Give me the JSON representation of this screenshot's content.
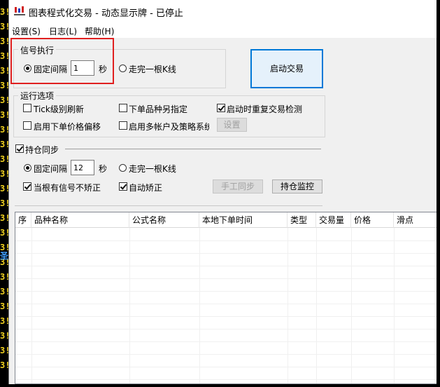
{
  "window": {
    "title": "图表程式化交易 - 动态显示牌 - 已停止",
    "app_icon_text": "财"
  },
  "menu": [
    "设置(S)",
    "日志(L)",
    "帮助(H)"
  ],
  "signal": {
    "legend": "信号执行",
    "fixed_interval_label": "固定间隔",
    "interval_value": "1",
    "seconds_unit": "秒",
    "bar_close_label": "走完一根K线",
    "fixed_selected": true
  },
  "start_button": "启动交易",
  "options": {
    "legend": "运行选项",
    "items": [
      {
        "label": "Tick级别刷新",
        "checked": false
      },
      {
        "label": "下单品种另指定",
        "checked": false
      },
      {
        "label": "启动时重复交易检测",
        "checked": true
      },
      {
        "label": "启用下单价格偏移",
        "checked": false
      },
      {
        "label": "启用多帐户及策略系统",
        "checked": false
      }
    ],
    "settings_button": "设置"
  },
  "position_sync": {
    "label": "持仓同步",
    "checked": true,
    "fixed_interval_label": "固定间隔",
    "interval_value": "12",
    "seconds_unit": "秒",
    "bar_close_label": "走完一根K线",
    "no_signal_label": "当根有信号不矫正",
    "no_signal_checked": true,
    "auto_correct_label": "自动矫正",
    "auto_correct_checked": true,
    "manual_sync_button": "手工同步",
    "monitor_button": "持仓监控"
  },
  "table": {
    "columns": [
      "序",
      "品种名称",
      "公式名称",
      "本地下单时间",
      "类型",
      "交易量",
      "价格",
      "滑点"
    ],
    "rows": []
  },
  "background_app": {
    "price_fragments": [
      "3!",
      "3!",
      "3!",
      "3!",
      "3!",
      "3!",
      "3!",
      "3!",
      "3!",
      "3!",
      "3!",
      "3!",
      "3!",
      "3!",
      "3!",
      "3!",
      "3!",
      "3!",
      "3!",
      "3!",
      "3!",
      "3!",
      "3!",
      "3!",
      "3!"
    ],
    "side_label": "圣"
  },
  "colors": {
    "highlight_box": "#e02020",
    "primary_border": "#0078d7"
  }
}
